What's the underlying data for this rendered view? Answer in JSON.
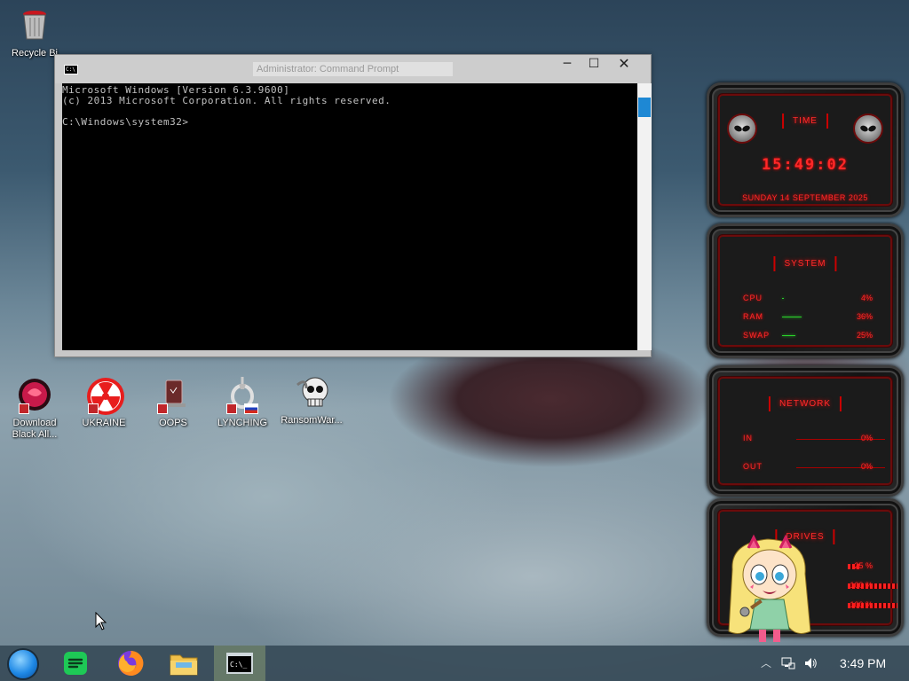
{
  "desktop": {
    "icons": [
      {
        "label": "Recycle Bi",
        "icon": "recycle-bin-icon"
      },
      {
        "label": "Download Black All...",
        "icon": "download-shortcut-icon"
      },
      {
        "label": "UKRAINE",
        "icon": "radiation-icon"
      },
      {
        "label": "OOPS",
        "icon": "oops-shortcut-icon"
      },
      {
        "label": "LYNCHING",
        "icon": "noose-icon"
      },
      {
        "label": "RansomWar...",
        "icon": "skull-icon"
      }
    ]
  },
  "console": {
    "title": "Administrator: Command Prompt",
    "lines": [
      "Microsoft Windows [Version 6.3.9600]",
      "(c) 2013 Microsoft Corporation. All rights reserved.",
      "",
      "C:\\Windows\\system32>"
    ],
    "buttons": {
      "minimize": "─",
      "maximize": "☐",
      "close": "✕"
    }
  },
  "gadgets": {
    "time": {
      "title": "TIME",
      "clock": "15:49:02",
      "date": "Sunday 14 September 2025"
    },
    "system": {
      "title": "SYSTEM",
      "rows": [
        {
          "label": "CPU",
          "value": "4%",
          "fraction": 0.04
        },
        {
          "label": "RAM",
          "value": "36%",
          "fraction": 0.36
        },
        {
          "label": "SWAP",
          "value": "25%",
          "fraction": 0.25
        }
      ]
    },
    "network": {
      "title": "NETWORK",
      "rows": [
        {
          "label": "IN",
          "value": "0%"
        },
        {
          "label": "OUT",
          "value": "0%"
        }
      ]
    },
    "drives": {
      "title": "DRIVES",
      "rows": [
        {
          "value": "25 %",
          "fraction": 0.25
        },
        {
          "value": "100 %",
          "fraction": 1.0
        },
        {
          "value": "100 %",
          "fraction": 1.0
        }
      ]
    }
  },
  "taskbar": {
    "apps": [
      {
        "name": "start-button"
      },
      {
        "name": "notes-app"
      },
      {
        "name": "firefox"
      },
      {
        "name": "file-explorer"
      },
      {
        "name": "command-prompt",
        "active": true
      }
    ],
    "clock": "3:49 PM"
  },
  "colors": {
    "accent_red": "#ff2828",
    "cmd_bg": "#000000",
    "taskbar": "#374b58"
  }
}
